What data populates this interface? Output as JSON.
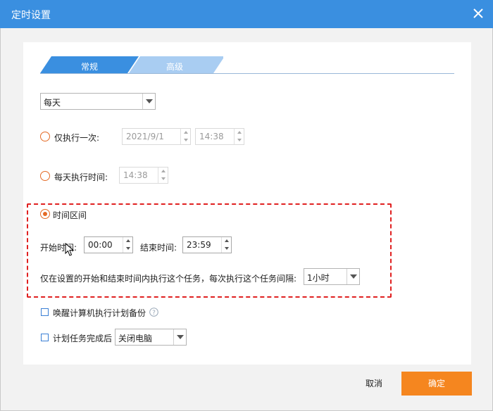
{
  "window": {
    "title": "定时设置",
    "close_icon": "close-icon"
  },
  "tabs": [
    {
      "label": "常规",
      "active": true
    },
    {
      "label": "高级",
      "active": false
    }
  ],
  "frequency_select": {
    "value": "每天"
  },
  "run_once": {
    "label": "仅执行一次:",
    "date": "2021/9/1",
    "time": "14:38",
    "checked": false
  },
  "daily_time": {
    "label": "每天执行时间:",
    "time": "14:38",
    "checked": false
  },
  "time_range": {
    "label": "时间区间",
    "checked": true,
    "start_label": "开始时间:",
    "start_value": "00:00",
    "end_label": "结束时间:",
    "end_value": "23:59",
    "interval_text": "仅在设置的开始和结束时间内执行这个任务，每次执行这个任务间隔:",
    "interval_value": "1小时"
  },
  "wake_computer": {
    "label": "唤醒计算机执行计划备份",
    "checked": false
  },
  "after_complete": {
    "label": "计划任务完成后",
    "action_value": "关闭电脑",
    "checked": false
  },
  "footer": {
    "cancel_label": "取消",
    "ok_label": "确定"
  },
  "colors": {
    "titlebar": "#3a8fe0",
    "tab_active": "#3a8fe0",
    "tab_inactive": "#a9cdf2",
    "radio_accent": "#e46a25",
    "highlight_border": "#e02020",
    "ok_button": "#f5861f"
  }
}
